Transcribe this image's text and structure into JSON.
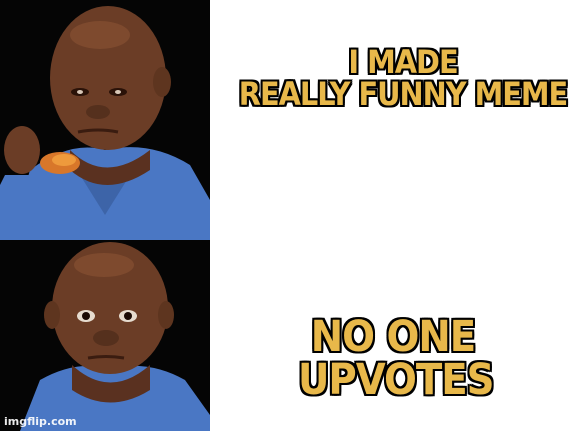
{
  "caption_top": [
    "I MADE",
    "REALLY FUNNY MEME"
  ],
  "caption_bottom": [
    "NO ONE",
    "UPVOTES"
  ],
  "watermark": "imgflip.com",
  "colors": {
    "caption_fill": "#e8b84a",
    "caption_outline": "#000000",
    "background": "#ffffff",
    "shirt": "#4a77c4",
    "skin": "#6b3d26"
  }
}
